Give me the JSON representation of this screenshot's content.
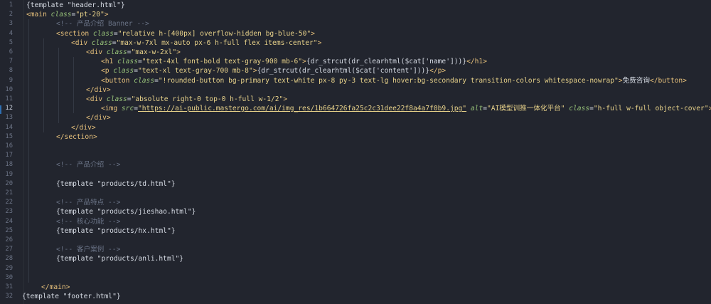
{
  "editor": {
    "lines": [
      {
        "num": "1",
        "segments": [
          [
            "t-plain",
            "{template \"header.html\"}"
          ]
        ]
      },
      {
        "num": "2",
        "segments": [
          [
            "t-tag",
            "<main "
          ],
          [
            "t-attr",
            "class"
          ],
          [
            "t-eq",
            "="
          ],
          [
            "t-str",
            "\"pt-20\""
          ],
          [
            "t-tag",
            ">"
          ]
        ]
      },
      {
        "num": "3",
        "segments": [
          [
            "t-comment",
            "<!-- 产品介绍 Banner -->"
          ]
        ]
      },
      {
        "num": "4",
        "segments": [
          [
            "t-tag",
            "<section "
          ],
          [
            "t-attr",
            "class"
          ],
          [
            "t-eq",
            "="
          ],
          [
            "t-str",
            "\"relative h-[400px] overflow-hidden bg-blue-50\""
          ],
          [
            "t-tag",
            ">"
          ]
        ]
      },
      {
        "num": "5",
        "segments": [
          [
            "t-tag",
            "<div "
          ],
          [
            "t-attr",
            "class"
          ],
          [
            "t-eq",
            "="
          ],
          [
            "t-str",
            "\"max-w-7xl mx-auto px-6 h-full flex items-center\""
          ],
          [
            "t-tag",
            ">"
          ]
        ]
      },
      {
        "num": "6",
        "segments": [
          [
            "t-tag",
            "<div "
          ],
          [
            "t-attr",
            "class"
          ],
          [
            "t-eq",
            "="
          ],
          [
            "t-str",
            "\"max-w-2xl\""
          ],
          [
            "t-tag",
            ">"
          ]
        ]
      },
      {
        "num": "7",
        "segments": [
          [
            "t-tag",
            "<h1 "
          ],
          [
            "t-attr",
            "class"
          ],
          [
            "t-eq",
            "="
          ],
          [
            "t-str",
            "\"text-4xl font-bold text-gray-900 mb-6\""
          ],
          [
            "t-tag",
            ">"
          ],
          [
            "t-php",
            "{dr_strcut(dr_clearhtml($cat['name']))}"
          ],
          [
            "t-tag",
            "</h1>"
          ]
        ]
      },
      {
        "num": "8",
        "segments": [
          [
            "t-tag",
            "<p "
          ],
          [
            "t-attr",
            "class"
          ],
          [
            "t-eq",
            "="
          ],
          [
            "t-str",
            "\"text-xl text-gray-700 mb-8\""
          ],
          [
            "t-tag",
            ">"
          ],
          [
            "t-php",
            "{dr_strcut(dr_clearhtml($cat['content']))}"
          ],
          [
            "t-tag",
            "</p>"
          ]
        ]
      },
      {
        "num": "9",
        "segments": [
          [
            "t-tag",
            "<button "
          ],
          [
            "t-attr",
            "class"
          ],
          [
            "t-eq",
            "="
          ],
          [
            "t-str",
            "\"!rounded-button bg-primary text-white px-8 py-3 text-lg hover:bg-secondary transition-colors whitespace-nowrap\""
          ],
          [
            "t-tag",
            ">"
          ],
          [
            "t-plain",
            "免费咨询"
          ],
          [
            "t-tag",
            "</button>"
          ]
        ]
      },
      {
        "num": "10",
        "segments": [
          [
            "t-tag",
            "</div>"
          ]
        ]
      },
      {
        "num": "11",
        "segments": [
          [
            "t-tag",
            "<div "
          ],
          [
            "t-attr",
            "class"
          ],
          [
            "t-eq",
            "="
          ],
          [
            "t-str",
            "\"absolute right-0 top-0 h-full w-1/2\""
          ],
          [
            "t-tag",
            ">"
          ]
        ]
      },
      {
        "num": "12",
        "segments": [
          [
            "t-tag",
            "<img "
          ],
          [
            "t-attr",
            "src"
          ],
          [
            "t-eq",
            "="
          ],
          [
            "t-url",
            "\"https://ai-public.mastergo.com/ai/img_res/1b664726fa25c2c31dee22f8a4a7f0b9.jpg\""
          ],
          [
            "t-plain",
            " "
          ],
          [
            "t-attr",
            "alt"
          ],
          [
            "t-eq",
            "="
          ],
          [
            "t-str",
            "\"AI模型训推一体化平台\""
          ],
          [
            "t-plain",
            " "
          ],
          [
            "t-attr",
            "class"
          ],
          [
            "t-eq",
            "="
          ],
          [
            "t-str",
            "\"h-full w-full object-cover\""
          ],
          [
            "t-tag",
            ">"
          ]
        ]
      },
      {
        "num": "13",
        "segments": [
          [
            "t-tag",
            "</div>"
          ]
        ]
      },
      {
        "num": "14",
        "segments": [
          [
            "t-tag",
            "</div>"
          ]
        ]
      },
      {
        "num": "15",
        "segments": [
          [
            "t-tag",
            "</section>"
          ]
        ]
      },
      {
        "num": "16",
        "segments": []
      },
      {
        "num": "17",
        "segments": []
      },
      {
        "num": "18",
        "segments": [
          [
            "t-comment",
            "<!-- 产品介绍 -->"
          ]
        ]
      },
      {
        "num": "19",
        "segments": []
      },
      {
        "num": "20",
        "segments": [
          [
            "t-plain",
            "{template \"products/td.html\"}"
          ]
        ]
      },
      {
        "num": "21",
        "segments": []
      },
      {
        "num": "22",
        "segments": [
          [
            "t-comment",
            "<!-- 产品特点 -->"
          ]
        ]
      },
      {
        "num": "23",
        "segments": [
          [
            "t-plain",
            "{template \"products/jieshao.html\"}"
          ]
        ]
      },
      {
        "num": "24",
        "segments": [
          [
            "t-comment",
            "<!-- 核心功能 -->"
          ]
        ]
      },
      {
        "num": "25",
        "segments": [
          [
            "t-plain",
            "{template \"products/hx.html\"}"
          ]
        ]
      },
      {
        "num": "26",
        "segments": []
      },
      {
        "num": "27",
        "segments": [
          [
            "t-comment",
            "<!-- 客户案例 -->"
          ]
        ]
      },
      {
        "num": "28",
        "segments": [
          [
            "t-plain",
            "{template \"products/anli.html\"}"
          ]
        ]
      },
      {
        "num": "29",
        "segments": []
      },
      {
        "num": "30",
        "segments": []
      },
      {
        "num": "31",
        "segments": [
          [
            "t-tag",
            "</main>"
          ]
        ]
      },
      {
        "num": "32",
        "segments": [
          [
            "t-plain",
            "{template \"footer.html\"}"
          ]
        ]
      }
    ]
  }
}
